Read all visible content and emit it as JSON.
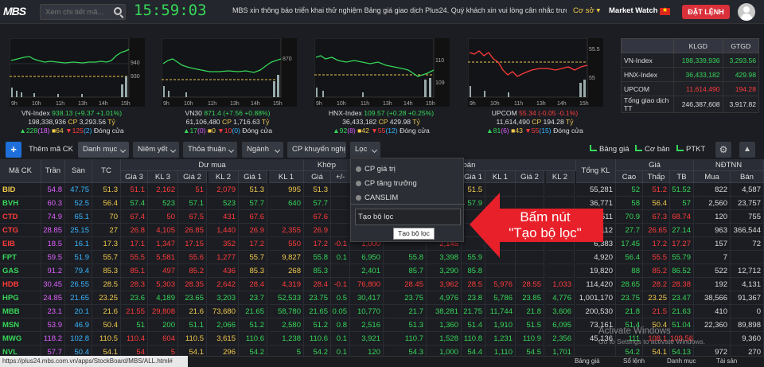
{
  "header": {
    "logo": "MBS",
    "search_placeholder": "Xem chi tiết mã...",
    "clock": "15:59:03",
    "marquee": "MBS xin thông báo triển khai thử nghiệm Bảng giá giao dịch Plus24. Quý khách xin vui lòng cân nhắc trước khi s",
    "base_label": "Cơ sở",
    "market_watch": "Market Watch",
    "order_button": "ĐẶT LỆNH"
  },
  "indices": [
    {
      "name": "VN-Index",
      "value": "938.13",
      "change": "(+9.37 +1.01%)",
      "volume": "198,338,936",
      "unit_cp": "CP",
      "amount": "3,293.56",
      "unit_ty": "Tỷ",
      "up": "▲228",
      "up_c": "(18)",
      "ref": "■64",
      "down": "▼125",
      "down_c": "(2)",
      "status": "Đóng cửa"
    },
    {
      "name": "VN30",
      "value": "871.4",
      "change": "(+7.56 +0.88%)",
      "volume": "61,106,480",
      "unit_cp": "CP",
      "amount": "1,716.63",
      "unit_ty": "Tỷ",
      "up": "▲17",
      "up_c": "(0)",
      "ref": "■0",
      "down": "▼10",
      "down_c": "(0)",
      "status": "Đóng cửa"
    },
    {
      "name": "HNX-Index",
      "value": "109.57",
      "change": "(+0.28 +0.25%)",
      "volume": "36,433,182",
      "unit_cp": "CP",
      "amount": "429.98",
      "unit_ty": "Tỷ",
      "up": "▲92",
      "up_c": "(8)",
      "ref": "■42",
      "down": "▼55",
      "down_c": "(12)",
      "status": "Đóng cửa"
    },
    {
      "name": "UPCOM",
      "value": "55.34",
      "change": "(-0.05 -0.1%)",
      "volume": "11,614,490",
      "unit_cp": "CP",
      "amount": "194.28",
      "unit_ty": "Tỷ",
      "up": "▲81",
      "up_c": "(6)",
      "ref": "■43",
      "down": "▼55",
      "down_c": "(15)",
      "status": "Đóng cửa"
    }
  ],
  "chart_labels": {
    "x_ticks": [
      "9h",
      "10h",
      "11h",
      "13h",
      "14h",
      "15h"
    ],
    "vn_index_y": [
      "940",
      "930"
    ],
    "vn30_y": [
      "870"
    ],
    "hnx_y": [
      "110",
      "109"
    ],
    "upcom_y": [
      "55.5",
      "55"
    ]
  },
  "summary": {
    "headers": [
      "",
      "KLGD",
      "GTGD"
    ],
    "rows": [
      [
        "VN-Index",
        "198,339,936",
        "3,293.56"
      ],
      [
        "HNX-Index",
        "36,433,182",
        "429.98"
      ],
      [
        "UPCOM",
        "11,614,490",
        "194.28"
      ],
      [
        "Tổng giao dịch TT",
        "246,387,608",
        "3,917.82"
      ]
    ]
  },
  "toolbar": {
    "add_symbol": "Thêm mã CK",
    "tabs": [
      "Danh mục",
      "Niêm yết",
      "Thỏa thuận",
      "Ngành",
      "CP khuyến nghị",
      "Lọc"
    ],
    "bang_gia": "Bảng giá",
    "co_ban": "Cơ bản",
    "ptkt": "PTKT"
  },
  "board_headers": {
    "symbol": "Mã CK",
    "ceil": "Trần",
    "floor": "Sàn",
    "ref": "TC",
    "buy_group": "Dư mua",
    "match_group": "Khớp",
    "sell_group": "Dư bán",
    "price_group": "Giá",
    "foreign_group": "NĐTNN",
    "buy": [
      "Giá 3",
      "KL 3",
      "Giá 2",
      "KL 2",
      "Giá 1",
      "KL 1"
    ],
    "match": [
      "Giá",
      "+/-"
    ],
    "sell": [
      "Giá 1",
      "KL 1",
      "Giá 2",
      "KL 2",
      "Giá 3",
      "KL 3"
    ],
    "total": "Tổng KL",
    "price": [
      "Cao",
      "Thấp",
      "TB"
    ],
    "foreign": [
      "Mua",
      "Bán"
    ]
  },
  "rows": [
    {
      "sym": "BID",
      "c": "54.8",
      "f": "47.75",
      "r": "51.3",
      "b": [
        "51.1",
        "2,162",
        "51",
        "2,079",
        "51.3",
        "995"
      ],
      "m": [
        "51.3",
        ""
      ],
      "mid": [],
      "s": [
        "51.5",
        "",
        "",
        "",
        "",
        ""
      ],
      "t": "55,281",
      "h": [
        "52",
        "51.2",
        "51.52"
      ],
      "fo": [
        "822",
        "4,587"
      ],
      "cls": "ref"
    },
    {
      "sym": "BVH",
      "c": "60.3",
      "f": "52.5",
      "r": "56.4",
      "b": [
        "57.4",
        "523",
        "57.1",
        "523",
        "57.7",
        "640"
      ],
      "m": [
        "57.7",
        ""
      ],
      "mid": [],
      "s": [
        "57.9",
        "",
        "",
        "",
        "",
        ""
      ],
      "t": "36,771",
      "h": [
        "58",
        "56.4",
        "57"
      ],
      "fo": [
        "2,560",
        "23,757"
      ],
      "cls": "up"
    },
    {
      "sym": "CTD",
      "c": "74.9",
      "f": "65.1",
      "r": "70",
      "b": [
        "67.4",
        "50",
        "67.5",
        "431",
        "67.6",
        "",
        "",
        ""
      ],
      "m": [
        "67.6",
        ""
      ],
      "mid": [],
      "s": [
        "",
        "",
        "",
        "",
        "",
        ""
      ],
      "t": "22,511",
      "h": [
        "70.9",
        "67.3",
        "68.74"
      ],
      "fo": [
        "120",
        "755"
      ],
      "cls": "dn"
    },
    {
      "sym": "CTG",
      "c": "28.85",
      "f": "25.15",
      "r": "27",
      "b": [
        "26.8",
        "4,105",
        "26.85",
        "1,440",
        "26.9",
        "2,355"
      ],
      "m": [
        "26.9",
        ""
      ],
      "mid": [],
      "s": [
        "",
        "",
        "",
        "",
        "",
        ""
      ],
      "t": "901,112",
      "h": [
        "27.7",
        "26.65",
        "27.14"
      ],
      "fo": [
        "963",
        "366,544"
      ],
      "cls": "dn"
    },
    {
      "sym": "EIB",
      "c": "18.5",
      "f": "16.1",
      "r": "17.3",
      "b": [
        "17.1",
        "1,347",
        "17.15",
        "352",
        "17.2",
        "550"
      ],
      "m": [
        "17.2",
        "-0.1"
      ],
      "mid": [
        "1,000",
        "",
        "2,145"
      ],
      "s": [
        "",
        "",
        "",
        "",
        "",
        ""
      ],
      "t": "6,383",
      "h": [
        "17.45",
        "17.2",
        "17.27"
      ],
      "fo": [
        "157",
        "72"
      ],
      "cls": "dn"
    },
    {
      "sym": "FPT",
      "c": "59.5",
      "f": "51.9",
      "r": "55.7",
      "b": [
        "55.5",
        "5,581",
        "55.6",
        "1,277",
        "55.7",
        "9,827"
      ],
      "m": [
        "55.8",
        "0.1"
      ],
      "mid": [
        "6,950",
        "55.8",
        "3,398"
      ],
      "s": [
        "55.9",
        "",
        "",
        "",
        "",
        ""
      ],
      "t": "4,920",
      "h": [
        "56.4",
        "55.5",
        "55.79"
      ],
      "fo": [
        "7",
        ""
      ],
      "cls": "up"
    },
    {
      "sym": "GAS",
      "c": "91.2",
      "f": "79.4",
      "r": "85.3",
      "b": [
        "85.1",
        "497",
        "85.2",
        "436",
        "85.3",
        "268"
      ],
      "m": [
        "85.3",
        ""
      ],
      "mid": [
        "2,401",
        "85.7",
        "3,290"
      ],
      "s": [
        "85.8",
        "",
        "",
        "",
        "",
        ""
      ],
      "t": "19,820",
      "h": [
        "88",
        "85.2",
        "86.52"
      ],
      "fo": [
        "522",
        "12,712"
      ],
      "cls": "up"
    },
    {
      "sym": "HDB",
      "c": "30.45",
      "f": "26.55",
      "r": "28.5",
      "b": [
        "28.3",
        "5,303",
        "28.35",
        "2,642",
        "28.4",
        "4,319"
      ],
      "m": [
        "28.4",
        "-0.1"
      ],
      "mid": [
        "76,800",
        "28.45",
        "3,962"
      ],
      "s": [
        "28.5",
        "5,976",
        "28.55",
        "1,033",
        "",
        "24,810"
      ],
      "t": "114,420",
      "h": [
        "28.65",
        "28.2",
        "28.38"
      ],
      "fo": [
        "192",
        "4,131"
      ],
      "cls": "dn"
    },
    {
      "sym": "HPG",
      "c": "24.85",
      "f": "21.65",
      "r": "23.25",
      "b": [
        "23.6",
        "4,189",
        "23.65",
        "3,203",
        "23.7",
        "52,533"
      ],
      "m": [
        "23.75",
        "0.5"
      ],
      "mid": [
        "30,417",
        "23.75",
        "4,976"
      ],
      "s": [
        "23.8",
        "5,786",
        "23.85",
        "4,776",
        "23.9",
        "17,430"
      ],
      "t": "1,001,170",
      "h": [
        "23.75",
        "23.25",
        "23.47"
      ],
      "fo": [
        "38,566",
        "91,367"
      ],
      "cls": "up"
    },
    {
      "sym": "MBB",
      "c": "23.1",
      "f": "20.1",
      "r": "21.6",
      "b": [
        "21.55",
        "29,808",
        "21.6",
        "73,680",
        "21.65",
        "58,780"
      ],
      "m": [
        "21.65",
        "0.05"
      ],
      "mid": [
        "10,770",
        "21.7",
        "38,281"
      ],
      "s": [
        "21.75",
        "11,744",
        "21.8",
        "3,606",
        "",
        "17,777"
      ],
      "t": "200,530",
      "h": [
        "21.8",
        "21.5",
        "21.63"
      ],
      "fo": [
        "410",
        "0"
      ],
      "cls": "up"
    },
    {
      "sym": "MSN",
      "c": "53.9",
      "f": "46.9",
      "r": "50.4",
      "b": [
        "51",
        "200",
        "51.1",
        "2,066",
        "51.2",
        "2,580"
      ],
      "m": [
        "51.2",
        "0.8"
      ],
      "mid": [
        "2,516",
        "51.3",
        "1,360"
      ],
      "s": [
        "51.4",
        "1,910",
        "51.5",
        "6,095",
        "",
        "9,055"
      ],
      "t": "73,161",
      "h": [
        "51.4",
        "50.4",
        "51.04"
      ],
      "fo": [
        "22,360",
        "89,898"
      ],
      "cls": "up"
    },
    {
      "sym": "MWG",
      "c": "118.2",
      "f": "102.8",
      "r": "110.5",
      "b": [
        "110.4",
        "604",
        "110.5",
        "3,615",
        "110.6",
        "1,238"
      ],
      "m": [
        "110.6",
        "0.1"
      ],
      "mid": [
        "3,921",
        "110.7",
        "1,528"
      ],
      "s": [
        "110.8",
        "1,231",
        "110.9",
        "2,356",
        "",
        "12,001"
      ],
      "t": "45,136",
      "h": [
        "111",
        "108.1",
        "109.56"
      ],
      "fo": [
        "",
        "9,360"
      ],
      "cls": "up"
    },
    {
      "sym": "NVL",
      "c": "57.7",
      "f": "50.4",
      "r": "54.1",
      "b": [
        "54",
        "5",
        "54.1",
        "296",
        "54.2",
        "5"
      ],
      "m": [
        "54.2",
        "0.1"
      ],
      "mid": [
        "120",
        "54.3",
        "1,000"
      ],
      "s": [
        "54.4",
        "1,110",
        "54.5",
        "1,701",
        "",
        "2,150"
      ],
      "t": "",
      "h": [
        "54.2",
        "54.1",
        "54.13"
      ],
      "fo": [
        "972",
        "270"
      ],
      "cls": "up"
    },
    {
      "sym": "PLX",
      "c": "56.6",
      "f": "49.2",
      "r": "52.9",
      "b": [
        "52.9",
        "2,177",
        "53",
        "1,635",
        "53.1",
        "5,230"
      ],
      "m": [
        "53.2",
        "0.3"
      ],
      "mid": [
        "4,580",
        "53.2",
        "",
        "",
        ""
      ],
      "s": [
        "53.3",
        "",
        "",
        "",
        "",
        ""
      ],
      "t": "6,280",
      "h": [
        "53.4",
        "52.8",
        "53.07"
      ],
      "fo": [
        "",
        "8,350"
      ],
      "cls": "up"
    }
  ],
  "filter_dropdown": {
    "items": [
      "CP giá trị",
      "CP tăng trưởng",
      "CANSLIM"
    ],
    "create_filter": "Tạo bộ lọc",
    "tooltip": "Tạo bộ lọc"
  },
  "annotation": {
    "line1": "Bấm nút",
    "line2": "\"Tạo bộ lọc\"",
    "arrow_color": "#e8202a"
  },
  "statusbar": {
    "url": "https://plus24.mbs.com.vn/apps/StockBoard/MBS/ALL.html#",
    "links": [
      "Bảng giá",
      "Sổ lệnh",
      "Danh mục",
      "Tài sản"
    ],
    "watermark1": "Activate Windows",
    "watermark2": "Go to Settings to activate Windows."
  },
  "colors": {
    "up": "#37d659",
    "down": "#ff3b3b",
    "ref": "#f2c94c",
    "ceil": "#e060ff",
    "floor": "#39b6ff"
  }
}
